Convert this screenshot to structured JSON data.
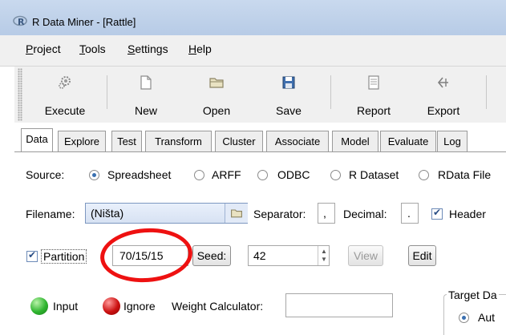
{
  "window": {
    "title": "R Data Miner - [Rattle]"
  },
  "menu": [
    {
      "accel": "P",
      "rest": "roject"
    },
    {
      "accel": "T",
      "rest": "ools"
    },
    {
      "accel": "S",
      "rest": "ettings"
    },
    {
      "accel": "H",
      "rest": "elp"
    }
  ],
  "toolbar": {
    "execute": "Execute",
    "new": "New",
    "open": "Open",
    "save": "Save",
    "report": "Report",
    "export": "Export"
  },
  "tabs": [
    "Data",
    "Explore",
    "Test",
    "Transform",
    "Cluster",
    "Associate",
    "Model",
    "Evaluate",
    "Log"
  ],
  "active_tab": "Data",
  "source": {
    "label": "Source:",
    "options": [
      "Spreadsheet",
      "ARFF",
      "ODBC",
      "R Dataset",
      "RData File"
    ],
    "selected": "Spreadsheet"
  },
  "filename": {
    "label": "Filename:",
    "value": "(Ništa)",
    "separator_label": "Separator:",
    "separator_value": ",",
    "decimal_label": "Decimal:",
    "decimal_value": ".",
    "header_label": "Header",
    "header_checked": true
  },
  "partition": {
    "label": "Partition",
    "checked": true,
    "value": "70/15/15",
    "seed_label": "Seed:",
    "seed_value": "42",
    "view_label": "View",
    "edit_label": "Edit"
  },
  "roles": {
    "input_label": "Input",
    "ignore_label": "Ignore",
    "weight_label": "Weight Calculator:",
    "weight_value": "",
    "target_group_label": "Target Da",
    "auto_label": "Aut"
  },
  "colors": {
    "input_dot": "#2fb52f",
    "ignore_dot": "#cc1111",
    "highlight": "#ee1111"
  }
}
